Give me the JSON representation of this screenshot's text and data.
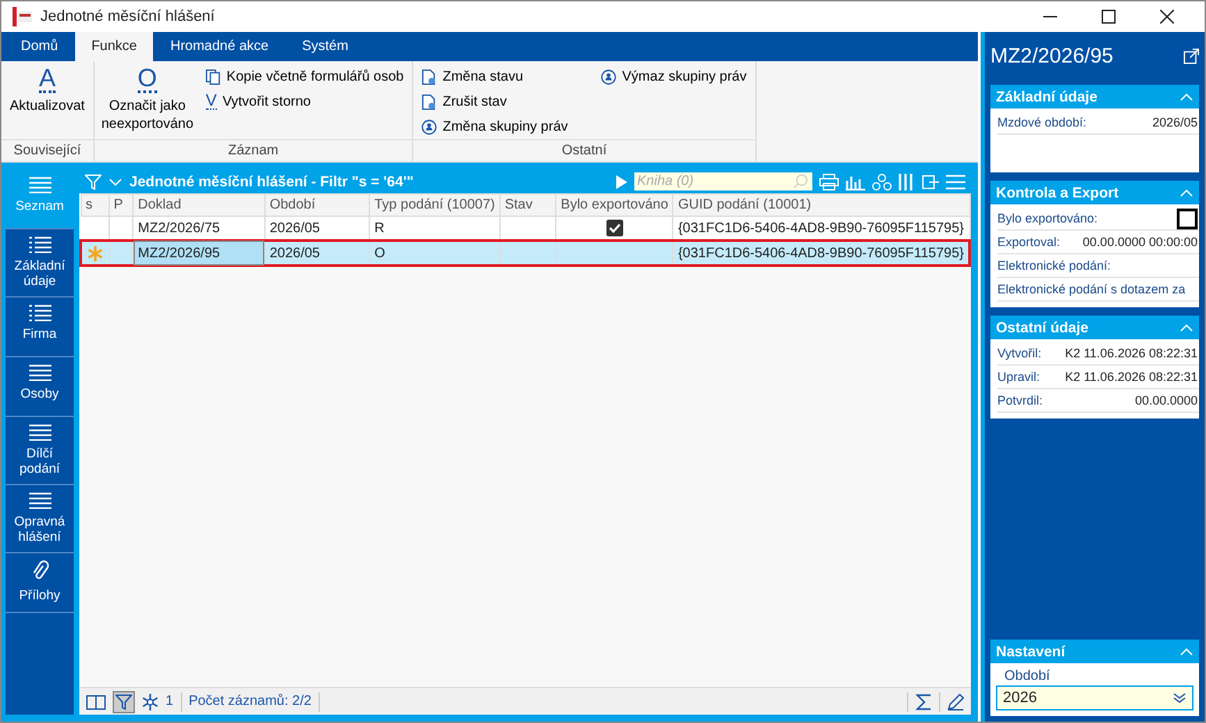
{
  "window": {
    "title": "Jednotné měsíční hlášení"
  },
  "ribbon_tabs": [
    {
      "label": "Domů",
      "selected": false
    },
    {
      "label": "Funkce",
      "selected": true
    },
    {
      "label": "Hromadné akce",
      "selected": false
    },
    {
      "label": "Systém",
      "selected": false
    }
  ],
  "ribbon_groups": [
    {
      "title": "Související",
      "large": [
        {
          "key": "A",
          "label": "Aktualizovat"
        }
      ]
    },
    {
      "title": "Záznam",
      "large": [
        {
          "key": "O",
          "label": "Označit jako neexportováno"
        }
      ],
      "small": [
        {
          "kind": "copy",
          "label": "Kopie včetně formulářů osob"
        },
        {
          "kind": "key",
          "key": "V",
          "label": "Vytvořit storno"
        }
      ]
    },
    {
      "title": "Ostatní",
      "small": [
        {
          "kind": "doc",
          "label": "Změna stavu"
        },
        {
          "kind": "doc",
          "label": "Zrušit stav"
        },
        {
          "kind": "group",
          "label": "Změna skupiny práv"
        },
        {
          "kind": "group",
          "label": "Výmaz skupiny práv"
        }
      ]
    }
  ],
  "nav": [
    {
      "label": "Seznam",
      "kind": "lines",
      "selected": true
    },
    {
      "label": "Základní údaje",
      "kind": "list",
      "selected": false
    },
    {
      "label": "Firma",
      "kind": "list",
      "selected": false
    },
    {
      "label": "Osoby",
      "kind": "lines",
      "selected": false
    },
    {
      "label": "Dílčí podání",
      "kind": "lines",
      "selected": false
    },
    {
      "label": "Opravná hlášení",
      "kind": "lines",
      "selected": false
    },
    {
      "label": "Přílohy",
      "kind": "clip",
      "selected": false
    }
  ],
  "table": {
    "title": "Jednotné měsíční hlášení - Filtr \"s = '64'\"",
    "search": {
      "placeholder": "Kniha (0)"
    },
    "columns": [
      "s",
      "P",
      "Doklad",
      "Období",
      "Typ podání (10007)",
      "Stav",
      "Bylo exportováno",
      "GUID podání (10001)"
    ],
    "rows": [
      {
        "marked": false,
        "doklad": "MZ2/2026/75",
        "obdobi": "2026/05",
        "typ": "R",
        "exported": true,
        "guid": "{031FC1D6-5406-4AD8-9B90-76095F115795}",
        "selected": false
      },
      {
        "marked": true,
        "doklad": "MZ2/2026/95",
        "obdobi": "2026/05",
        "typ": "O",
        "exported": false,
        "guid": "{031FC1D6-5406-4AD8-9B90-76095F115795}",
        "selected": true
      }
    ]
  },
  "status_bar": {
    "filter_count": "1",
    "records": "Počet záznamů: 2/2"
  },
  "detail": {
    "title": "MZ2/2026/95",
    "sections": [
      {
        "title": "Základní údaje",
        "fields": [
          {
            "kind": "text",
            "label": "Mzdové období:",
            "value": "2026/05"
          }
        ]
      },
      {
        "title": "Kontrola a Export",
        "fields": [
          {
            "kind": "checkbox",
            "label": "Bylo exportováno:",
            "checked": false
          },
          {
            "kind": "text",
            "label": "Exportoval:",
            "value": "00.00.0000 00:00:00"
          },
          {
            "kind": "text",
            "label": "Elektronické podání:"
          },
          {
            "kind": "text",
            "label": "Elektronické podání s dotazem za"
          }
        ]
      },
      {
        "title": "Ostatní údaje",
        "fields": [
          {
            "kind": "text",
            "label": "Vytvořil:",
            "value": "K2 11.06.2026 08:22:31"
          },
          {
            "kind": "text",
            "label": "Upravil:",
            "value": "K2 11.06.2026 08:22:31"
          },
          {
            "kind": "text",
            "label": "Potvrdil:",
            "value": "00.00.0000"
          }
        ]
      }
    ],
    "settings": {
      "title": "Nastavení",
      "field_label": "Období",
      "field_value": "2026"
    }
  }
}
